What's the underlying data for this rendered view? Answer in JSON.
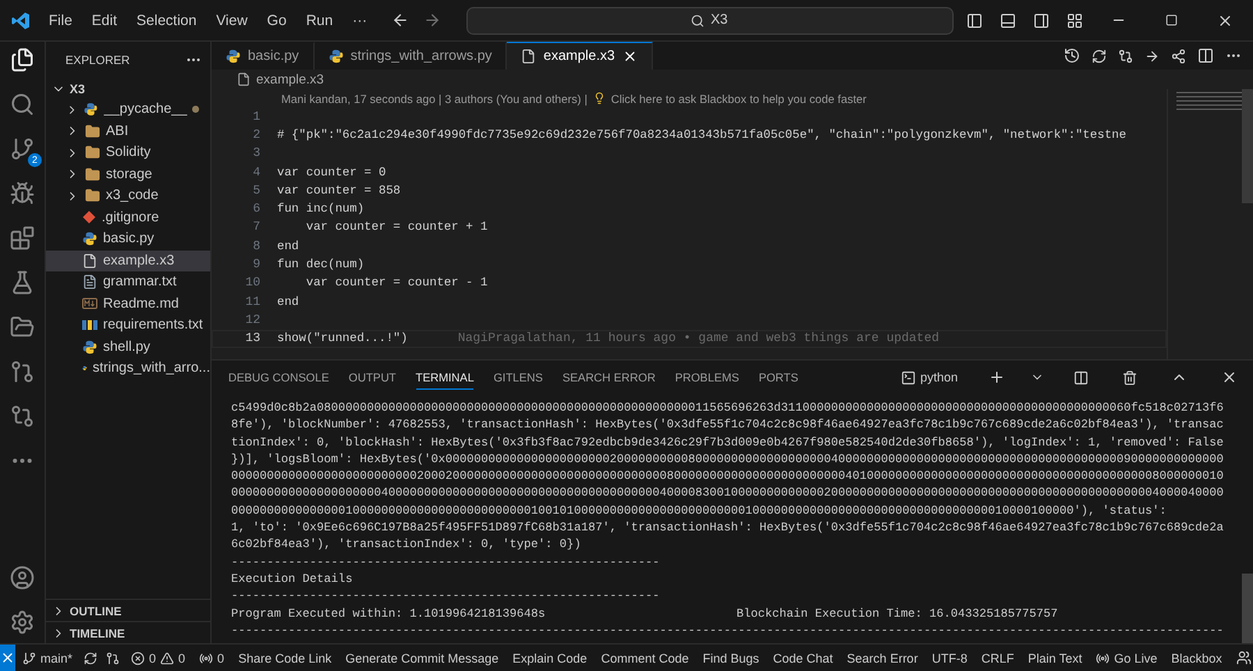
{
  "title_bar": {
    "menu": [
      "File",
      "Edit",
      "Selection",
      "View",
      "Go",
      "Run",
      "···"
    ],
    "search": "X3"
  },
  "activity_bar": {
    "badge": "2"
  },
  "sidebar": {
    "title": "EXPLORER",
    "root": "X3",
    "items": [
      {
        "name": "__pycache__",
        "kind": "pyfolder",
        "modified": true,
        "selected": false
      },
      {
        "name": "ABI",
        "kind": "folder",
        "modified": false,
        "selected": false
      },
      {
        "name": "Solidity",
        "kind": "folder",
        "modified": false,
        "selected": false
      },
      {
        "name": "storage",
        "kind": "folder",
        "modified": false,
        "selected": false
      },
      {
        "name": "x3_code",
        "kind": "folder",
        "modified": false,
        "selected": false
      },
      {
        "name": ".gitignore",
        "kind": "git",
        "modified": false,
        "selected": false
      },
      {
        "name": "basic.py",
        "kind": "python",
        "modified": false,
        "selected": false
      },
      {
        "name": "example.x3",
        "kind": "file",
        "modified": false,
        "selected": true
      },
      {
        "name": "grammar.txt",
        "kind": "text",
        "modified": false,
        "selected": false
      },
      {
        "name": "Readme.md",
        "kind": "markdown",
        "modified": false,
        "selected": false
      },
      {
        "name": "requirements.txt",
        "kind": "requirements",
        "modified": false,
        "selected": false
      },
      {
        "name": "shell.py",
        "kind": "python",
        "modified": false,
        "selected": false
      },
      {
        "name": "strings_with_arro...",
        "kind": "python",
        "modified": false,
        "selected": false
      }
    ],
    "sections": [
      "OUTLINE",
      "TIMELINE"
    ]
  },
  "editor": {
    "tabs": [
      {
        "label": "basic.py",
        "kind": "python",
        "selected": false
      },
      {
        "label": "strings_with_arrows.py",
        "kind": "python",
        "selected": false
      },
      {
        "label": "example.x3",
        "kind": "file",
        "selected": true
      }
    ],
    "breadcrumb": "example.x3",
    "codelens": "Mani kandan, 17 seconds ago | 3 authors (You and others) |",
    "codelens_link": "Click here to ask Blackbox to help you code faster",
    "lines": [
      {
        "number": "1",
        "current": false
      },
      {
        "number": "2",
        "text": "# {\"pk\":\"6c2a1c294e30f4990fdc7735e92c69d232e756f70a8234a01343b571fa05c05e\", \"chain\":\"polygonzkevm\", \"network\":\"testne",
        "current": false
      },
      {
        "number": "3",
        "current": false
      },
      {
        "number": "4",
        "text": "var counter = 0",
        "current": false
      },
      {
        "number": "5",
        "text": "var counter = 858",
        "current": false
      },
      {
        "number": "6",
        "text": "fun inc(num)",
        "current": false
      },
      {
        "number": "7",
        "text": "    var counter = counter + 1",
        "current": false
      },
      {
        "number": "8",
        "text": "end",
        "current": false
      },
      {
        "number": "9",
        "text": "fun dec(num)",
        "current": false
      },
      {
        "number": "10",
        "text": "    var counter = counter - 1",
        "current": false
      },
      {
        "number": "11",
        "text": "end",
        "current": false
      },
      {
        "number": "12",
        "current": false
      },
      {
        "number": "13",
        "text": "show(\"runned...!\")",
        "current": true
      }
    ],
    "blame": "NagiPragalathan, 11 hours ago • game and web3 things are updated"
  },
  "panel": {
    "tabs": [
      {
        "label": "DEBUG CONSOLE",
        "selected": false
      },
      {
        "label": "OUTPUT",
        "selected": false
      },
      {
        "label": "TERMINAL",
        "selected": true
      },
      {
        "label": "GITLENS",
        "selected": false
      },
      {
        "label": "SEARCH ERROR",
        "selected": false
      },
      {
        "label": "PROBLEMS",
        "selected": false
      },
      {
        "label": "PORTS",
        "selected": false
      }
    ],
    "shell": "python",
    "terminal": [
      {
        "kind": "line",
        "text": "c5499d0c8b2a0800000000000000000000000000000000000000000000000000011565696263d3110000000000000000000000000000000000000000000060fc518c02713f6"
      },
      {
        "kind": "line",
        "text": "8fe'), 'blockNumber': 47682553, 'transactionHash': HexBytes('0x3dfe55f1c704c2c8c98f46ae64927ea3fc78c1b9c767c689cde2a6c02bf84ea3'), 'transac"
      },
      {
        "kind": "line",
        "text": "tionIndex': 0, 'blockHash': HexBytes('0x3fb3f8ac792edbcb9de3426c29f7b3d009e0b4267f980e582540d2de30fb8658'), 'logIndex': 1, 'removed': False"
      },
      {
        "kind": "line",
        "text": "})], 'logsBloom': HexBytes('0x0000000000000000000000020000000000800000000000000000004000000000000000000000000000000000000000090000000000000"
      },
      {
        "kind": "line",
        "text": "0000000000000000000000000020002000000000000000000000000000000800000000000000000000000040100000000000000000000000000000000000000008000000010"
      },
      {
        "kind": "line",
        "text": "0000000000000000000004000000000000000000000000000000000000004000083001000000000000020000000000000000000000000000000000000000000004000040000"
      },
      {
        "kind": "line",
        "text": "0000000000000000100000000000000000000000001001010000000000000000000000001000000000000000000000000000000000010000100000'), 'status':"
      },
      {
        "kind": "line",
        "text": "1, 'to': '0x9Ee6c696C197B8a25f495FF51D897fC68b31a187', 'transactionHash': HexBytes('0x3dfe55f1c704c2c8c98f46ae64927ea3fc78c1b9c767c689cde2a"
      },
      {
        "kind": "line",
        "text": "6c02bf84ea3'), 'transactionIndex': 0, 'type': 0})"
      },
      {
        "kind": "line",
        "text": "------------------------------------------------------------"
      },
      {
        "kind": "line",
        "text": "Execution Details"
      },
      {
        "kind": "line",
        "text": "------------------------------------------------------------"
      },
      {
        "kind": "pair",
        "left": "Program Executed within: 1.1019964218139648s",
        "right": "Blockchain Execution Time: 16.043325185775757"
      },
      {
        "kind": "line",
        "text": "-------------------------------------------------------------------------------------------------------------------------------------------"
      }
    ]
  },
  "status_bar": {
    "branch": "main*",
    "errors": "0",
    "warnings": "0",
    "ports": "0",
    "actions": [
      "Share Code Link",
      "Generate Commit Message",
      "Explain Code",
      "Comment Code",
      "Find Bugs",
      "Code Chat",
      "Search Error"
    ],
    "right": [
      {
        "kind": "text",
        "label": "UTF-8"
      },
      {
        "kind": "text",
        "label": "CRLF"
      },
      {
        "kind": "text",
        "label": "Plain Text"
      },
      {
        "kind": "live",
        "label": "Go Live"
      },
      {
        "kind": "text",
        "label": "Blackbox"
      }
    ]
  }
}
